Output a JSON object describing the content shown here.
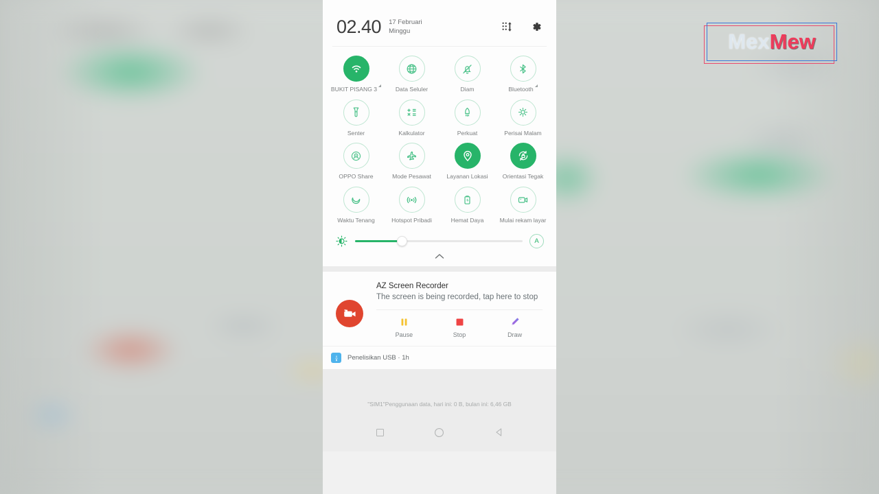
{
  "status": {
    "clock": "02.40",
    "date_line1": "17 Februari",
    "date_line2": "Minggu",
    "edit_icon": "edit-tiles-icon",
    "settings_icon": "gear-icon"
  },
  "quick_settings": {
    "tiles": [
      {
        "label": "BUKIT PISANG 3",
        "icon": "wifi-icon",
        "on": true,
        "expandable": true
      },
      {
        "label": "Data Seluler",
        "icon": "globe-icon",
        "on": false,
        "expandable": false
      },
      {
        "label": "Diam",
        "icon": "mute-bell-icon",
        "on": false,
        "expandable": false
      },
      {
        "label": "Bluetooth",
        "icon": "bluetooth-icon",
        "on": false,
        "expandable": true
      },
      {
        "label": "Senter",
        "icon": "flashlight-icon",
        "on": false,
        "expandable": false
      },
      {
        "label": "Kalkulator",
        "icon": "calculator-icon",
        "on": false,
        "expandable": false
      },
      {
        "label": "Perkuat",
        "icon": "boost-icon",
        "on": false,
        "expandable": false
      },
      {
        "label": "Perisai Malam",
        "icon": "night-shield-icon",
        "on": false,
        "expandable": false
      },
      {
        "label": "OPPO Share",
        "icon": "oppo-share-icon",
        "on": false,
        "expandable": false
      },
      {
        "label": "Mode Pesawat",
        "icon": "airplane-icon",
        "on": false,
        "expandable": false
      },
      {
        "label": "Layanan Lokasi",
        "icon": "location-pin-icon",
        "on": true,
        "expandable": false
      },
      {
        "label": "Orientasi Tegak",
        "icon": "rotation-lock-icon",
        "on": true,
        "expandable": false
      },
      {
        "label": "Waktu Tenang",
        "icon": "moon-icon",
        "on": false,
        "expandable": false
      },
      {
        "label": "Hotspot Pribadi",
        "icon": "hotspot-icon",
        "on": false,
        "expandable": false
      },
      {
        "label": "Hemat Daya",
        "icon": "battery-saver-icon",
        "on": false,
        "expandable": false
      },
      {
        "label": "Mulai rekam layar",
        "icon": "screen-record-icon",
        "on": false,
        "expandable": false
      }
    ],
    "brightness": {
      "icon": "brightness-icon",
      "percent": 28,
      "auto_label": "A"
    },
    "expand_icon": "chevron-up-icon"
  },
  "notification": {
    "app_icon": "video-camera-icon",
    "title": "AZ Screen Recorder",
    "message": "The screen is being recorded, tap here to stop",
    "actions": [
      {
        "label": "Pause",
        "icon": "pause-icon",
        "color": "#f5c231"
      },
      {
        "label": "Stop",
        "icon": "stop-icon",
        "color": "#ef4444"
      },
      {
        "label": "Draw",
        "icon": "pencil-icon",
        "color": "#9a6ae0"
      }
    ]
  },
  "notification_small": {
    "icon": "usb-icon",
    "text": "Penelisikan USB · 1h"
  },
  "footer": {
    "sim_text": "\"SIM1\"Penggunaan data, hari ini: 0 B, bulan ini: 6,46 GB"
  },
  "navbar": {
    "recents": "recents-square-icon",
    "home": "home-circle-icon",
    "back": "back-triangle-icon"
  },
  "watermark": {
    "text_light": "Mex",
    "text_bold": "Mew"
  },
  "colors": {
    "accent_green": "#27b469",
    "tile_outline": "#bfe6d2",
    "notif_red": "#e0452f",
    "usb_blue": "#4eb3ec"
  }
}
